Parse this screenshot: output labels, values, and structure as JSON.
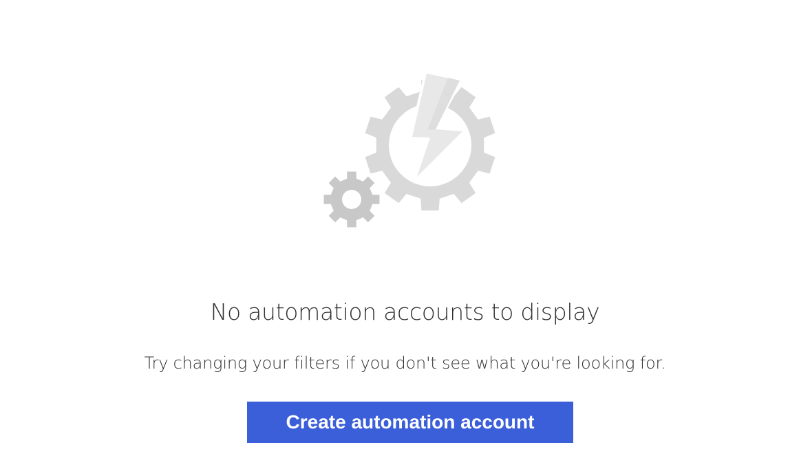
{
  "empty_state": {
    "illustration_icon": "automation-gears-lightning-icon",
    "headline": "No automation accounts to display",
    "subtext": "Try changing your filters if you don't see what you're looking for.",
    "create_button_label": "Create automation account"
  },
  "colors": {
    "accent": "#3b5fd9",
    "gear_large": "#d9d9d9",
    "gear_small": "#c8c8c8",
    "bolt": "#e8e8e8",
    "text": "#323130"
  }
}
